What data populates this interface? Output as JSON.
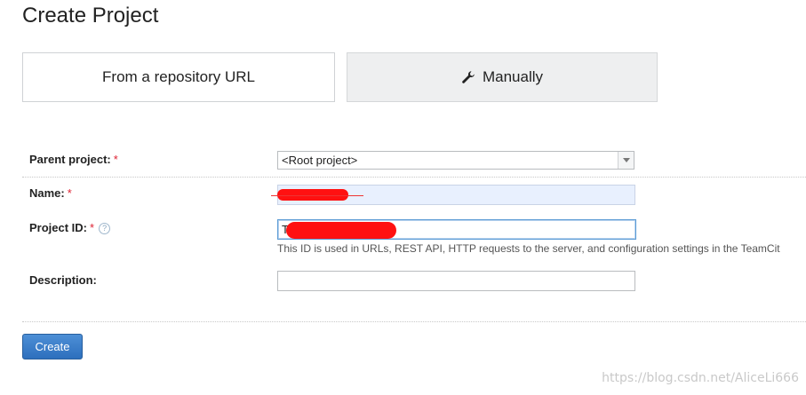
{
  "page": {
    "title": "Create Project"
  },
  "modes": {
    "repo_label": "From a repository URL",
    "manual_label": "Manually",
    "manual_icon": "wrench-icon",
    "selected": "manual"
  },
  "form": {
    "parent": {
      "label": "Parent project:",
      "required": "*",
      "value": "<Root project>"
    },
    "name": {
      "label": "Name:",
      "required": "*",
      "value": ""
    },
    "project_id": {
      "label": "Project ID:",
      "required": "*",
      "help": "?",
      "value": "T",
      "hint": "This ID is used in URLs, REST API, HTTP requests to the server, and configuration settings in the TeamCit"
    },
    "description": {
      "label": "Description:",
      "value": ""
    }
  },
  "actions": {
    "create_label": "Create"
  },
  "watermark": "https://blog.csdn.net/AliceLi666",
  "colors": {
    "required": "#dd2233",
    "button": "#3b7fcc",
    "redaction": "#ff1111"
  }
}
